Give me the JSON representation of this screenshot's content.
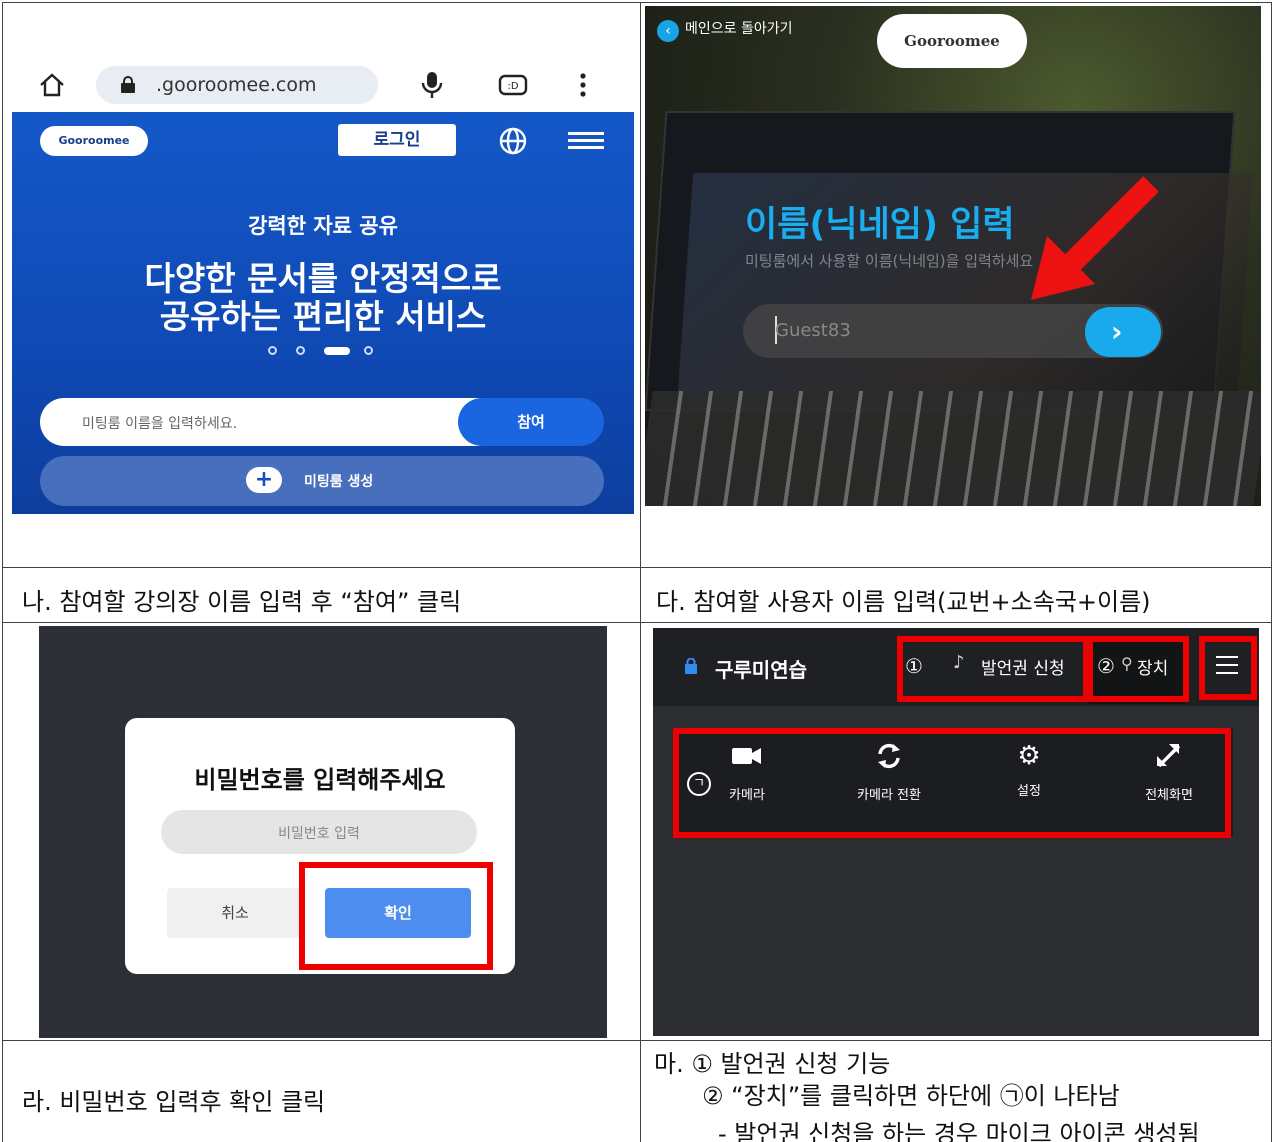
{
  "captions": {
    "na": "나. 참여할 강의장 이름 입력 후 “참여” 클릭",
    "da": "다. 참여할 사용자 이름 입력(교번+소속국+이름)",
    "ra": "라. 비밀번호 입력후 확인 클릭",
    "ma_line1": "마. ① 발언권 신청 기능",
    "ma_line2": "② “장치”를 클릭하면 하단에 ㉠이 나타남",
    "ma_line3": "- 발언권 신청을 하는 경우 마이크 아이콘 생성됨"
  },
  "panel_a": {
    "url": ".gooroomee.com",
    "logo": "Gooroomee",
    "login_label": "로그인",
    "subtitle": "강력한 자료 공유",
    "headline_1": "다양한 문서를 안정적으로",
    "headline_2": "공유하는 편리한 서비스",
    "meeting_placeholder": "미팅룸 이름을 입력하세요.",
    "join_label": "참여",
    "plus": "+",
    "create_label": "미팅룸 생성",
    "carousel_total": 4,
    "carousel_active": 3
  },
  "panel_b": {
    "back_label": "메인으로 돌아가기",
    "logo": "Gooroomee",
    "title": "이름(닉네임) 입력",
    "subtitle": "미팅룸에서 사용할 이름(닉네임)을 입력하세요",
    "nickname_placeholder": "Guest83",
    "go_icon": "chevron-right-icon",
    "arrow_color": "#ee1111"
  },
  "panel_c": {
    "dialog_title": "비밀번호를 입력해주세요",
    "password_placeholder": "비밀번호 입력",
    "cancel_label": "취소",
    "confirm_label": "확인",
    "highlight_color": "#ee0000"
  },
  "panel_d": {
    "room_name": "구루미연습",
    "marker_1": "①",
    "speak_request_label": "발언권 신청",
    "marker_2": "②",
    "device_label": "장치",
    "marker_k": "ㄱ",
    "tools": [
      {
        "icon": "video-camera-icon",
        "label": "카메라"
      },
      {
        "icon": "camera-switch-icon",
        "label": "카메라 전환"
      },
      {
        "icon": "gear-icon",
        "label": "설정"
      },
      {
        "icon": "fullscreen-icon",
        "label": "전체화면"
      }
    ]
  }
}
